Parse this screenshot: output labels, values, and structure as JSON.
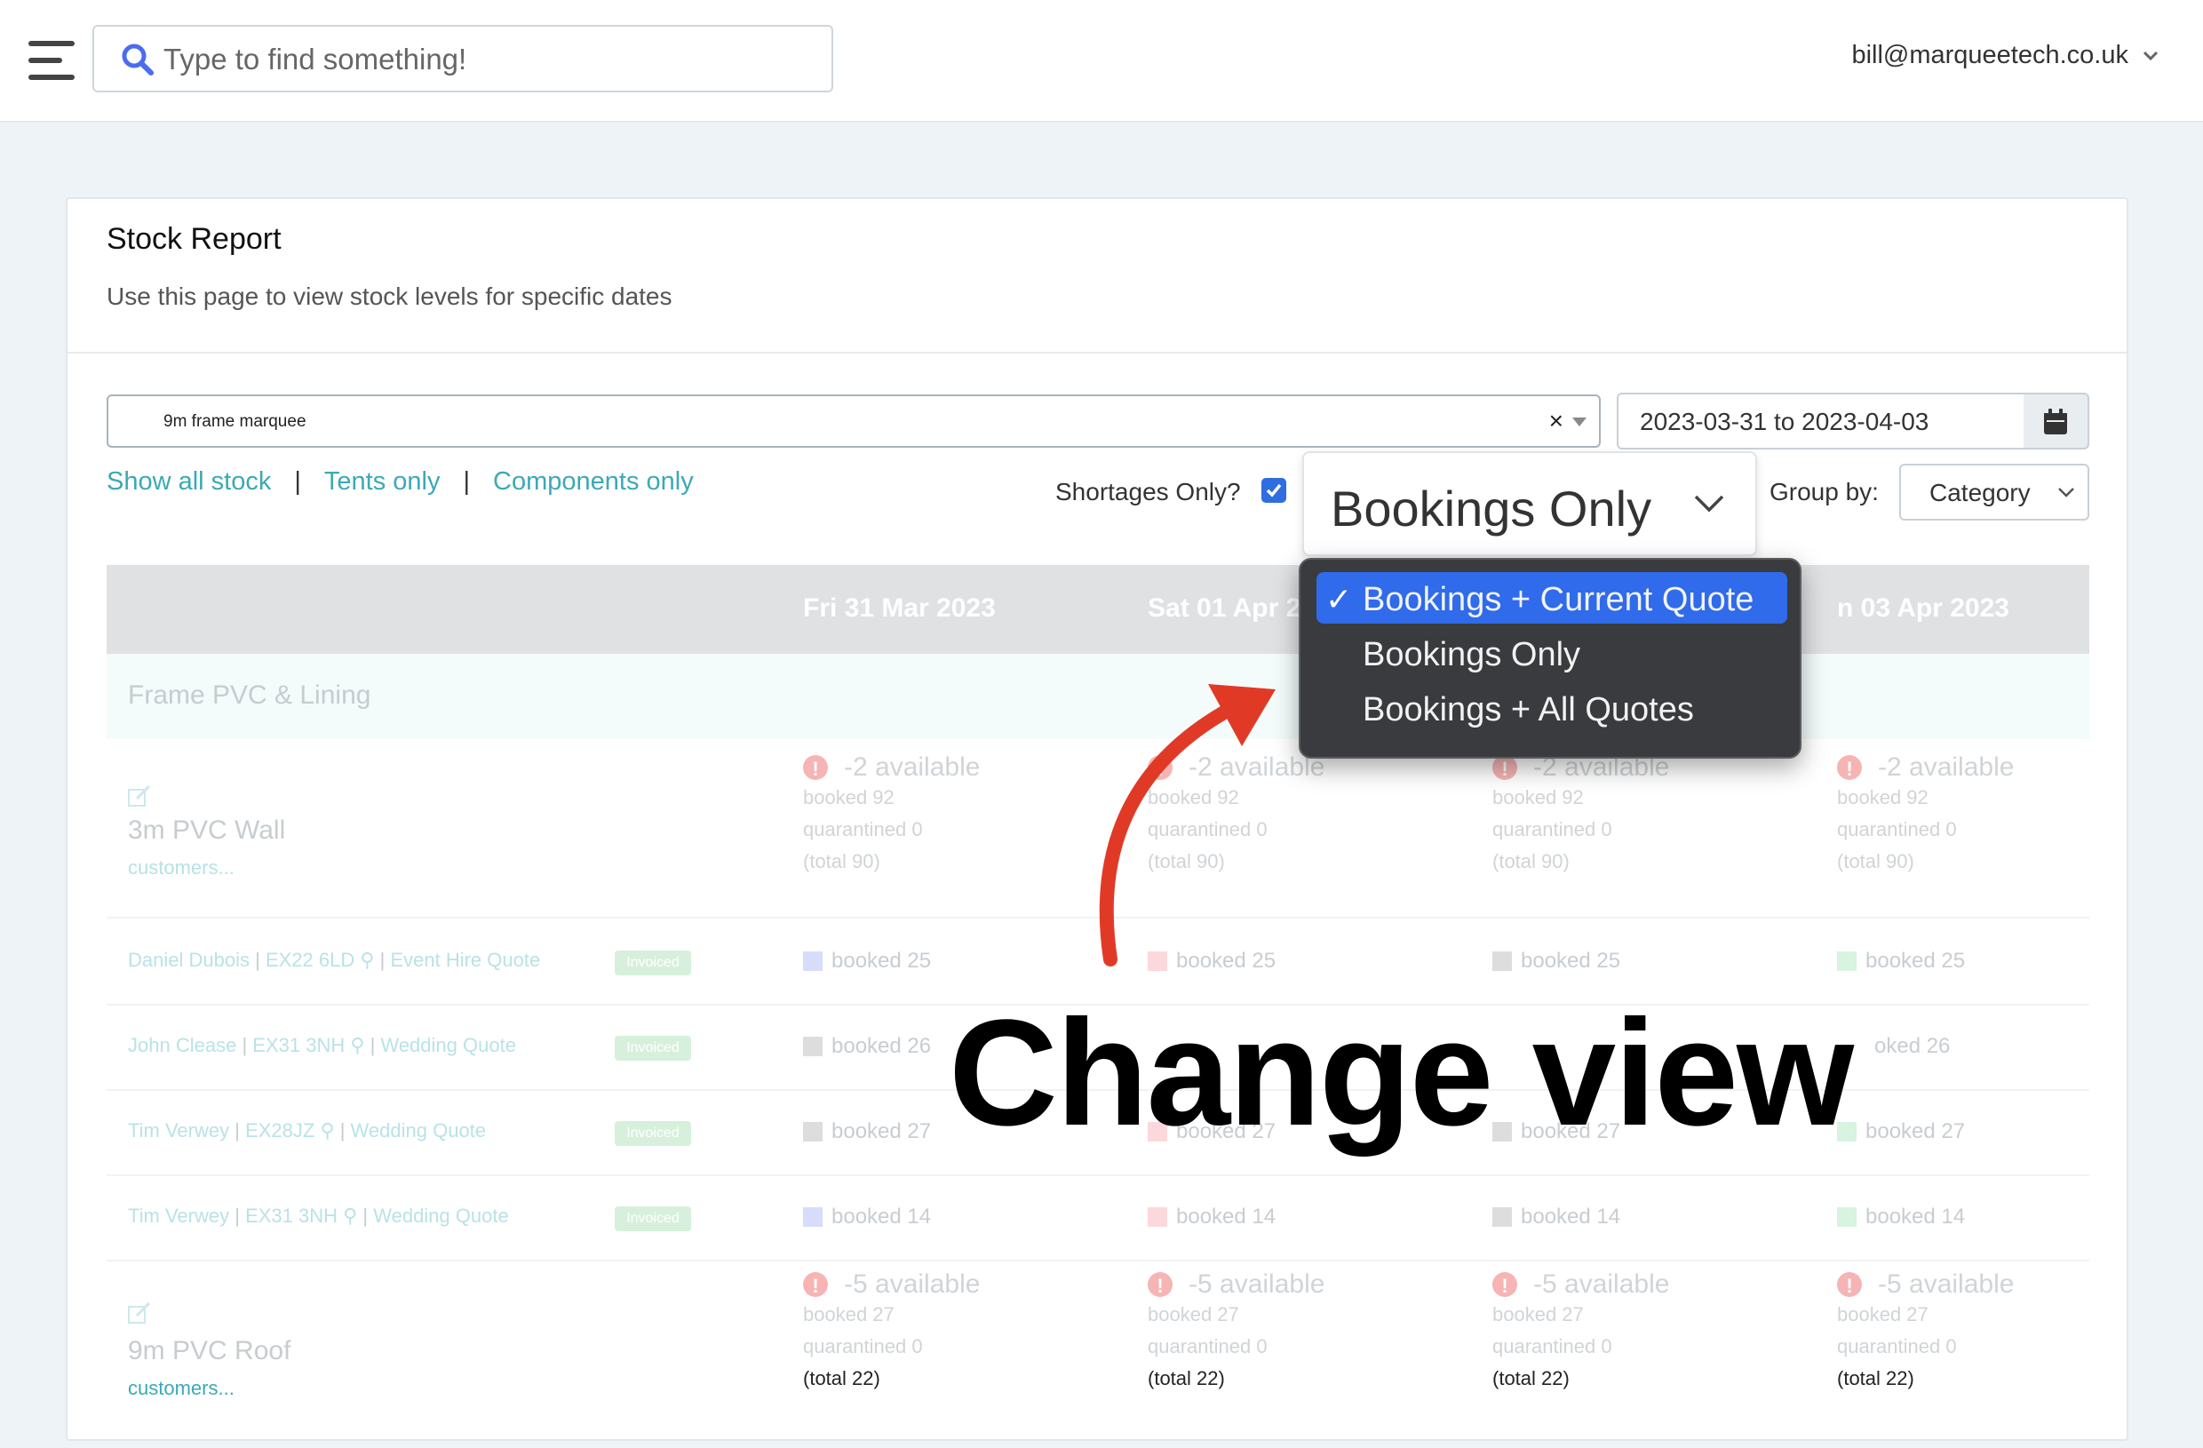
{
  "header": {
    "search_placeholder": "Type to find something!",
    "user_email": "bill@marqueetech.co.uk"
  },
  "page": {
    "title": "Stock Report",
    "subtitle": "Use this page to view stock levels for specific dates"
  },
  "filters": {
    "product_value": "9m frame marquee",
    "product_clear": "×",
    "date_range": "2023-03-31 to 2023-04-03",
    "links": [
      "Show all stock",
      "Tents only",
      "Components only"
    ],
    "link_separator": "|",
    "shortages_label": "Shortages Only?",
    "shortages_checked": true,
    "view_value": "Bookings Only",
    "group_by_label": "Group by:",
    "group_by_value": "Category"
  },
  "view_dropdown": {
    "check_mark": "✓",
    "options": [
      {
        "label": "Bookings + Current Quote",
        "selected": true
      },
      {
        "label": "Bookings Only",
        "selected": false
      },
      {
        "label": "Bookings + All Quotes",
        "selected": false
      }
    ]
  },
  "table": {
    "columns": [
      "Fri 31 Mar 2023",
      "Sat 01 Apr 2023",
      "",
      "n 03 Apr 2023"
    ],
    "category": "Frame PVC & Lining",
    "items": [
      {
        "name": "3m PVC Wall",
        "customers_link": "customers...",
        "cells": [
          {
            "available": "-2 available",
            "booked": "booked 92",
            "quarantined": "quarantined 0",
            "total": "(total 90)"
          },
          {
            "available": "-2 available",
            "booked": "booked 92",
            "quarantined": "quarantined 0",
            "total": "(total 90)"
          },
          {
            "available": "-2 available",
            "booked": "booked 92",
            "quarantined": "quarantined 0",
            "total": "(total 90)"
          },
          {
            "available": "-2 available",
            "booked": "booked 92",
            "quarantined": "quarantined 0",
            "total": "(total 90)"
          }
        ]
      },
      {
        "name": "9m PVC Roof",
        "customers_link": "customers...",
        "cells": [
          {
            "available": "-5 available",
            "booked": "booked 27",
            "quarantined": "quarantined 0",
            "total": "(total 22)"
          },
          {
            "available": "-5 available",
            "booked": "booked 27",
            "quarantined": "quarantined 0",
            "total": "(total 22)"
          },
          {
            "available": "-5 available",
            "booked": "booked 27",
            "quarantined": "quarantined 0",
            "total": "(total 22)"
          },
          {
            "available": "-5 available",
            "booked": "booked 27",
            "quarantined": "quarantined 0",
            "total": "(total 22)"
          }
        ]
      }
    ],
    "bookings": [
      {
        "customer": "Daniel Dubois",
        "postcode": "EX22 6LD",
        "quote": "Event Hire Quote",
        "status": "Invoiced",
        "cells": [
          "booked 25",
          "booked 25",
          "booked 25",
          "booked 25"
        ],
        "colors": [
          "#d8dcfb",
          "#fbd8dc",
          "#dddddd",
          "#d8f3df"
        ]
      },
      {
        "customer": "John Clease",
        "postcode": "EX31 3NH",
        "quote": "Wedding Quote",
        "status": "Invoiced",
        "cells": [
          "booked 26",
          "",
          "",
          "oked 26"
        ],
        "colors": [
          "#dddddd",
          "#fbd8dc",
          "#dddddd",
          "#d8f3df"
        ]
      },
      {
        "customer": "Tim Verwey",
        "postcode": "EX28JZ",
        "quote": "Wedding Quote",
        "status": "Invoiced",
        "cells": [
          "booked 27",
          "booked 27",
          "booked 27",
          "booked 27"
        ],
        "colors": [
          "#dddddd",
          "#fbd8dc",
          "#dddddd",
          "#d8f3df"
        ]
      },
      {
        "customer": "Tim Verwey",
        "postcode": "EX31 3NH",
        "quote": "Wedding Quote",
        "status": "Invoiced",
        "cells": [
          "booked 14",
          "booked 14",
          "booked 14",
          "booked 14"
        ],
        "colors": [
          "#d8dcfb",
          "#fbd8dc",
          "#dddddd",
          "#d8f3df"
        ]
      }
    ]
  },
  "annotation": {
    "text": "Change view",
    "arrow_color": "#e03a26"
  }
}
